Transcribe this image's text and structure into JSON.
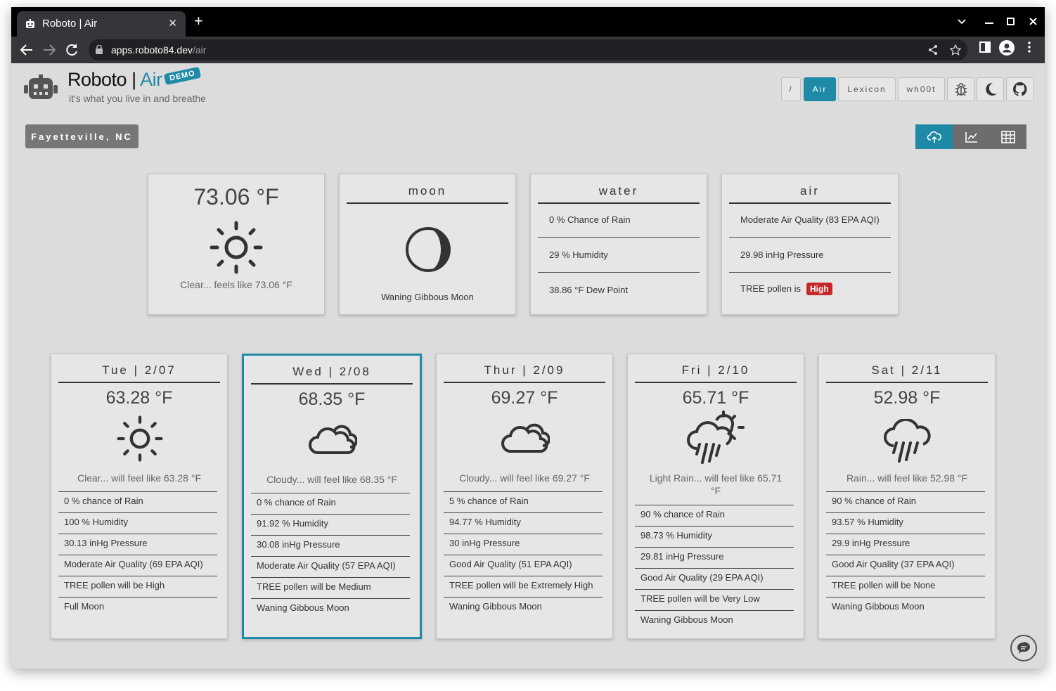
{
  "browser": {
    "tab_title": "Roboto | Air",
    "tab_close": "✕",
    "new_tab": "+",
    "url_host": "apps.roboto84.dev",
    "url_path": "/air"
  },
  "header": {
    "brand_name": "Roboto | ",
    "brand_air": "Air",
    "demo_badge": "DEMO",
    "tagline": "it's what you live in and breathe"
  },
  "nav": {
    "root_label": "/",
    "air_label": "Air",
    "lexicon_label": "Lexicon",
    "whoot_label": "wh00t"
  },
  "location": "Fayetteville, NC",
  "current": {
    "temp": "73.06 °F",
    "desc": "Clear... feels like 73.06 °F",
    "icon": "sun-icon"
  },
  "moon": {
    "title": "moon",
    "phase": "Waning Gibbous Moon"
  },
  "water": {
    "title": "water",
    "rows": [
      "0 % Chance of Rain",
      "29 % Humidity",
      "38.86 °F Dew Point"
    ]
  },
  "air": {
    "title": "air",
    "rows": [
      "Moderate Air Quality (83 EPA AQI)",
      "29.98 inHg Pressure"
    ],
    "pollen_label": "TREE pollen is",
    "pollen_level": "High",
    "pollen_color": "#c62828"
  },
  "accent_color": "#1f8aa8",
  "forecast": [
    {
      "day": "Tue | 2/07",
      "temp": "63.28 °F",
      "icon": "sun-icon",
      "desc": "Clear... will feel like 63.28 °F",
      "rows": [
        "0 % chance of Rain",
        "100 % Humidity",
        "30.13 inHg Pressure",
        "Moderate Air Quality (69 EPA AQI)",
        "TREE pollen will be High",
        "Full Moon"
      ]
    },
    {
      "day": "Wed | 2/08",
      "temp": "68.35 °F",
      "icon": "cloud-icon",
      "desc": "Cloudy... will feel like 68.35 °F",
      "rows": [
        "0 % chance of Rain",
        "91.92 % Humidity",
        "30.08 inHg Pressure",
        "Moderate Air Quality (57 EPA AQI)",
        "TREE pollen will be Medium",
        "Waning Gibbous Moon"
      ]
    },
    {
      "day": "Thur | 2/09",
      "temp": "69.27 °F",
      "icon": "cloud-icon",
      "desc": "Cloudy... will feel like 69.27 °F",
      "rows": [
        "5 % chance of Rain",
        "94.77 % Humidity",
        "30 inHg Pressure",
        "Good Air Quality (51 EPA AQI)",
        "TREE pollen will be Extremely High",
        "Waning Gibbous Moon"
      ]
    },
    {
      "day": "Fri | 2/10",
      "temp": "65.71 °F",
      "icon": "sun-rain-icon",
      "desc_line1": "Light Rain... will feel like 65.71",
      "desc_line2": "°F",
      "rows": [
        "90 % chance of Rain",
        "98.73 % Humidity",
        "29.81 inHg Pressure",
        "Good Air Quality (29 EPA AQI)",
        "TREE pollen will be Very Low",
        "Waning Gibbous Moon"
      ]
    },
    {
      "day": "Sat | 2/11",
      "temp": "52.98 °F",
      "icon": "rain-icon",
      "desc": "Rain... will feel like 52.98 °F",
      "rows": [
        "90 % chance of Rain",
        "93.57 % Humidity",
        "29.9 inHg Pressure",
        "Good Air Quality (37 EPA AQI)",
        "TREE pollen will be None",
        "Waning Gibbous Moon"
      ]
    }
  ]
}
